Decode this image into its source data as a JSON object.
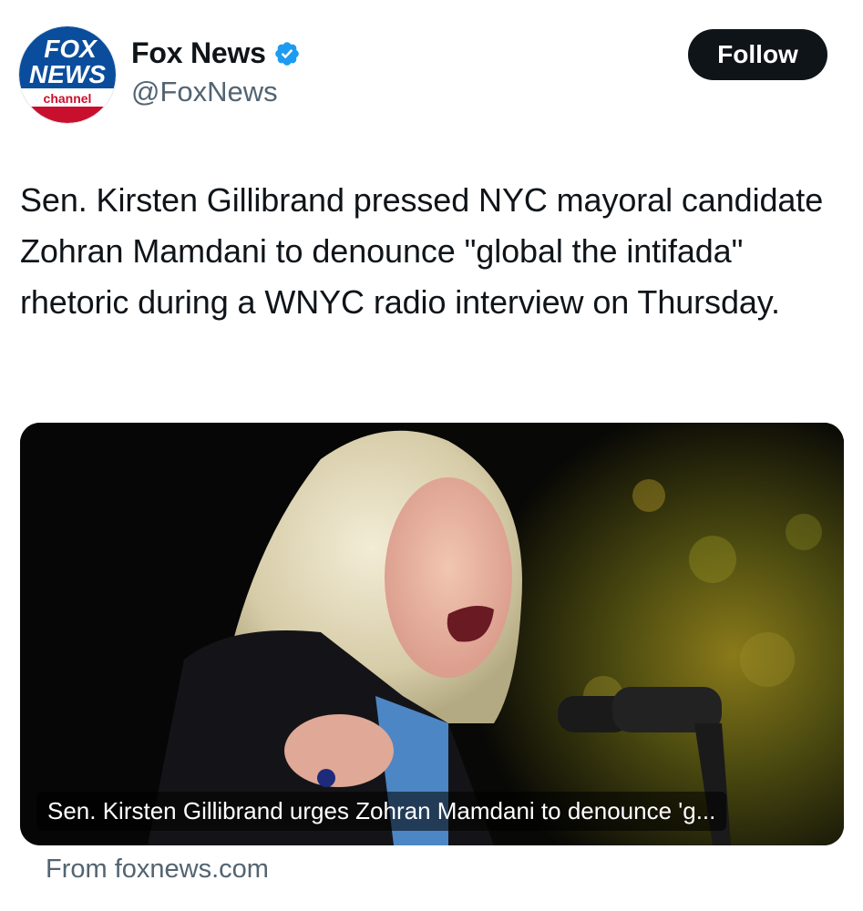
{
  "author": {
    "display_name": "Fox News",
    "handle": "@FoxNews",
    "verified": true,
    "avatar_logo": {
      "line1": "FOX",
      "line2": "NEWS",
      "line3": "channel"
    }
  },
  "follow_button": {
    "label": "Follow"
  },
  "tweet": {
    "text": "Sen. Kirsten Gillibrand pressed NYC mayoral candidate Zohran Mamdani to denounce \"global the intifada\" rhetoric during a WNYC radio interview on Thursday."
  },
  "link_card": {
    "caption": "Sen. Kirsten Gillibrand urges Zohran Mamdani to denounce 'g...",
    "source": "From foxnews.com"
  },
  "colors": {
    "text_primary": "#0f1419",
    "text_secondary": "#536471",
    "verified_blue": "#1d9bf0",
    "fox_blue": "#003f87",
    "fox_red": "#c8102e"
  },
  "icons": [
    "fox-news-logo-icon",
    "verified-badge-icon"
  ]
}
